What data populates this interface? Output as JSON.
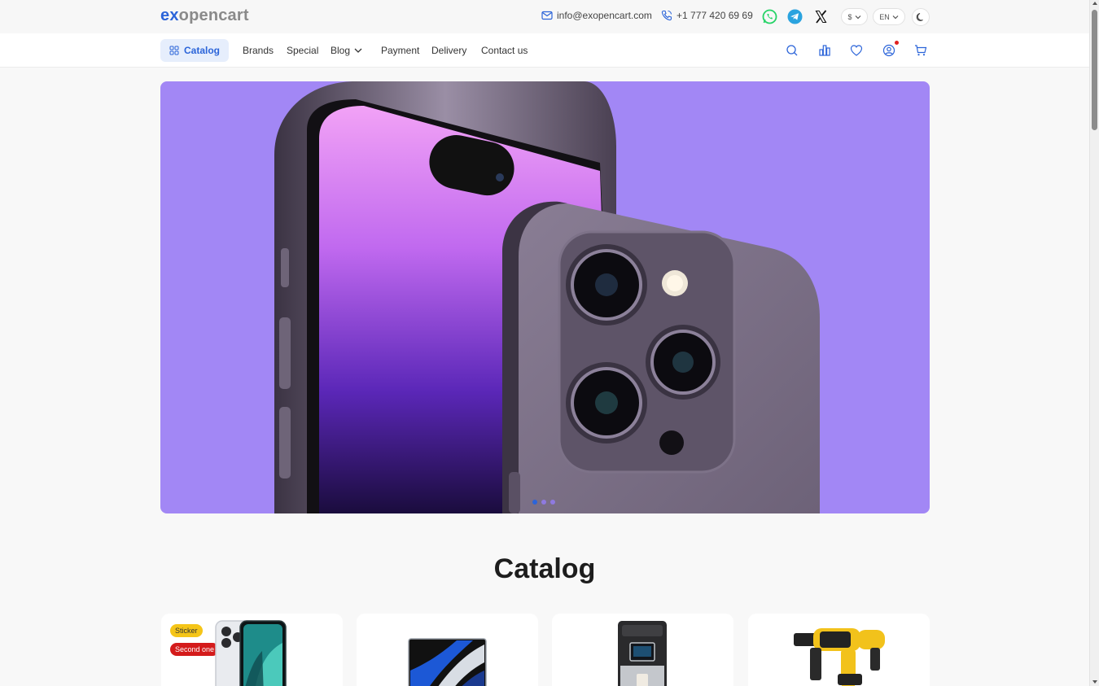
{
  "logo": {
    "part1": "ex",
    "part2": "opencart"
  },
  "topbar": {
    "email": "info@exopencart.com",
    "phone": "+1 777 420 69 69",
    "currency": "$",
    "language": "EN"
  },
  "nav": {
    "catalog_label": "Catalog",
    "items": [
      "Brands",
      "Special",
      "Blog",
      "Payment",
      "Delivery",
      "Contact us"
    ]
  },
  "colors": {
    "accent": "#2b64d9",
    "banner_bg": "#a287f5",
    "badge_sticker": "#f5c518",
    "badge_second": "#d41b1b",
    "whatsapp": "#25d366",
    "telegram": "#2aa3df"
  },
  "section": {
    "title": "Catalog"
  },
  "cards": [
    {
      "badges": [
        "Sticker",
        "Second one"
      ],
      "icon": "iphone-13-pro-image"
    },
    {
      "icon": "macbook-pro-image"
    },
    {
      "icon": "coffee-machine-image"
    },
    {
      "icon": "dewalt-drill-image"
    }
  ],
  "slider": {
    "dots": 3,
    "active": 1
  }
}
